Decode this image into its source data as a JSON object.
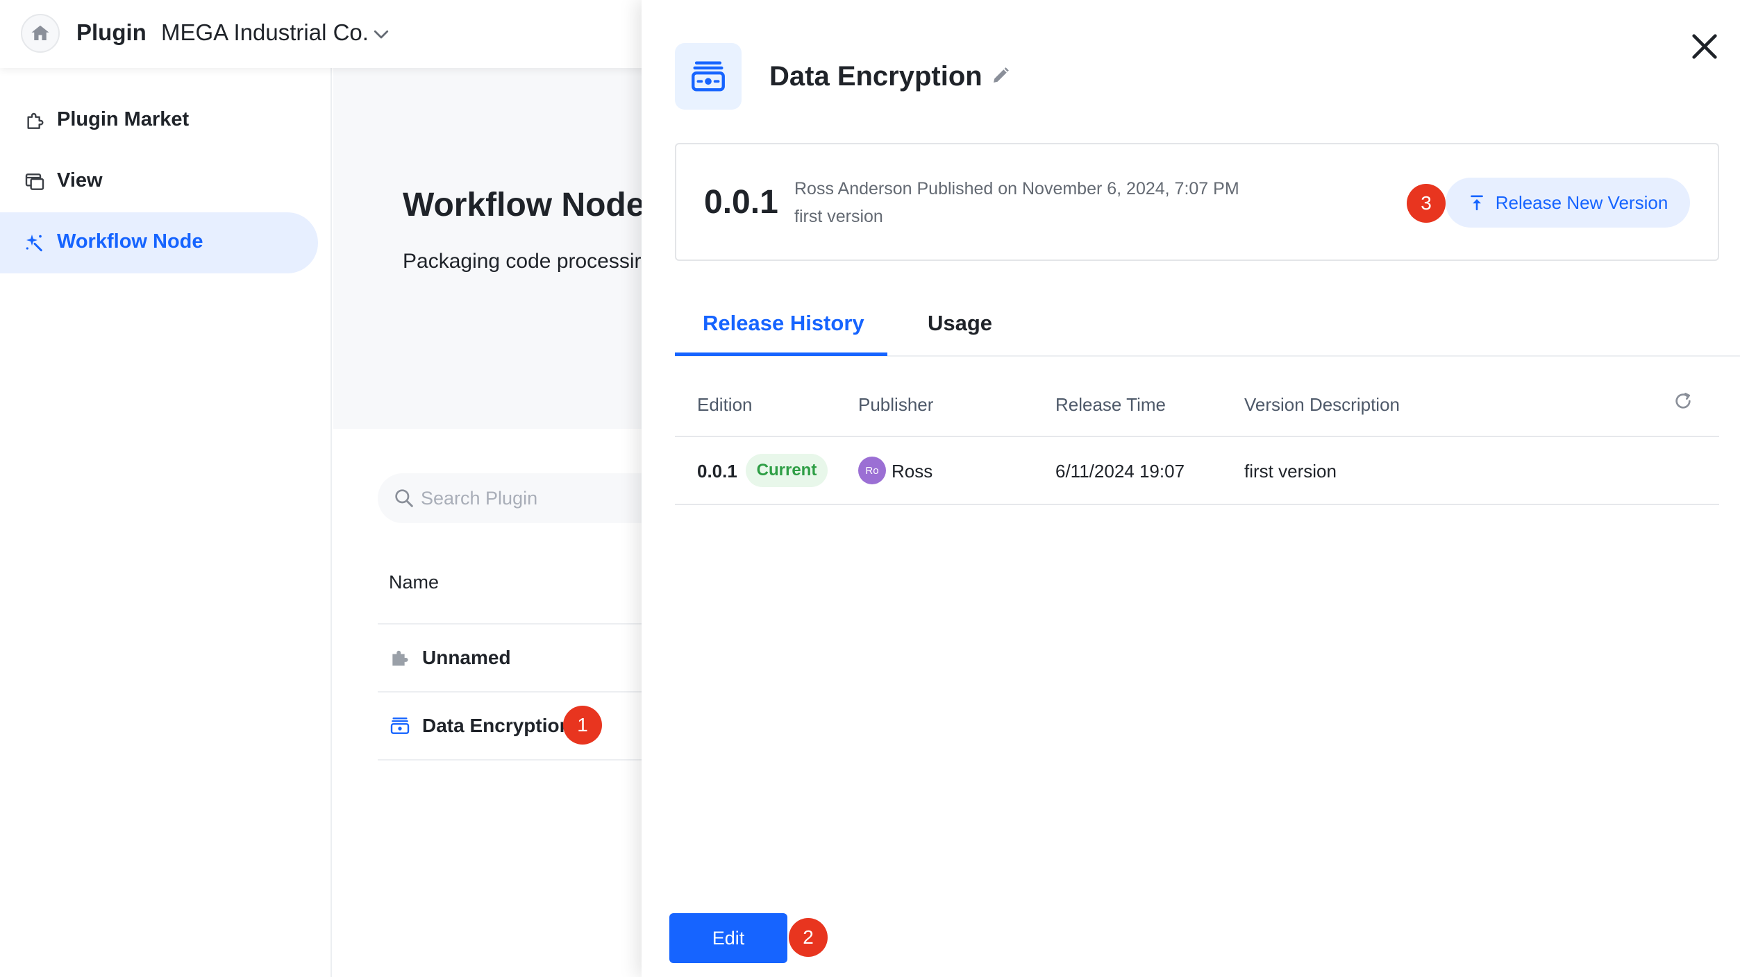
{
  "header": {
    "app_name": "Plugin",
    "org_name": "MEGA Industrial Co."
  },
  "sidebar": {
    "items": [
      {
        "label": "Plugin Market",
        "icon": "puzzle-icon",
        "active": false
      },
      {
        "label": "View",
        "icon": "window-stack-icon",
        "active": false
      },
      {
        "label": "Workflow Node",
        "icon": "sparkle-wand-icon",
        "active": true
      }
    ]
  },
  "main": {
    "title": "Workflow Node",
    "description": "Packaging code processir",
    "search_placeholder": "Search Plugin",
    "list_header": "Name",
    "plugins": [
      {
        "name": "Unnamed",
        "icon": "puzzle-piece-icon"
      },
      {
        "name": "Data Encryption",
        "icon": "encryption-box-icon"
      }
    ]
  },
  "drawer": {
    "title": "Data Encryption",
    "current_version": "0.0.1",
    "publish_meta": "Ross Anderson Published on November 6, 2024, 7:07 PM",
    "version_note": "first version",
    "release_button": "Release New Version",
    "tabs": [
      {
        "label": "Release History",
        "active": true
      },
      {
        "label": "Usage",
        "active": false
      }
    ],
    "table": {
      "columns": [
        "Edition",
        "Publisher",
        "Release Time",
        "Version Description"
      ],
      "rows": [
        {
          "edition": "0.0.1",
          "badge": "Current",
          "avatar_initials": "Ro",
          "publisher": "Ross",
          "release_time": "6/11/2024 19:07",
          "description": "first version"
        }
      ]
    },
    "edit_button": "Edit"
  },
  "step_markers": [
    "1",
    "2",
    "3"
  ],
  "colors": {
    "accent": "#1664ff",
    "accent_soft": "#e7efff",
    "marker_red": "#e8351f",
    "current_green": "#2e9e45"
  }
}
